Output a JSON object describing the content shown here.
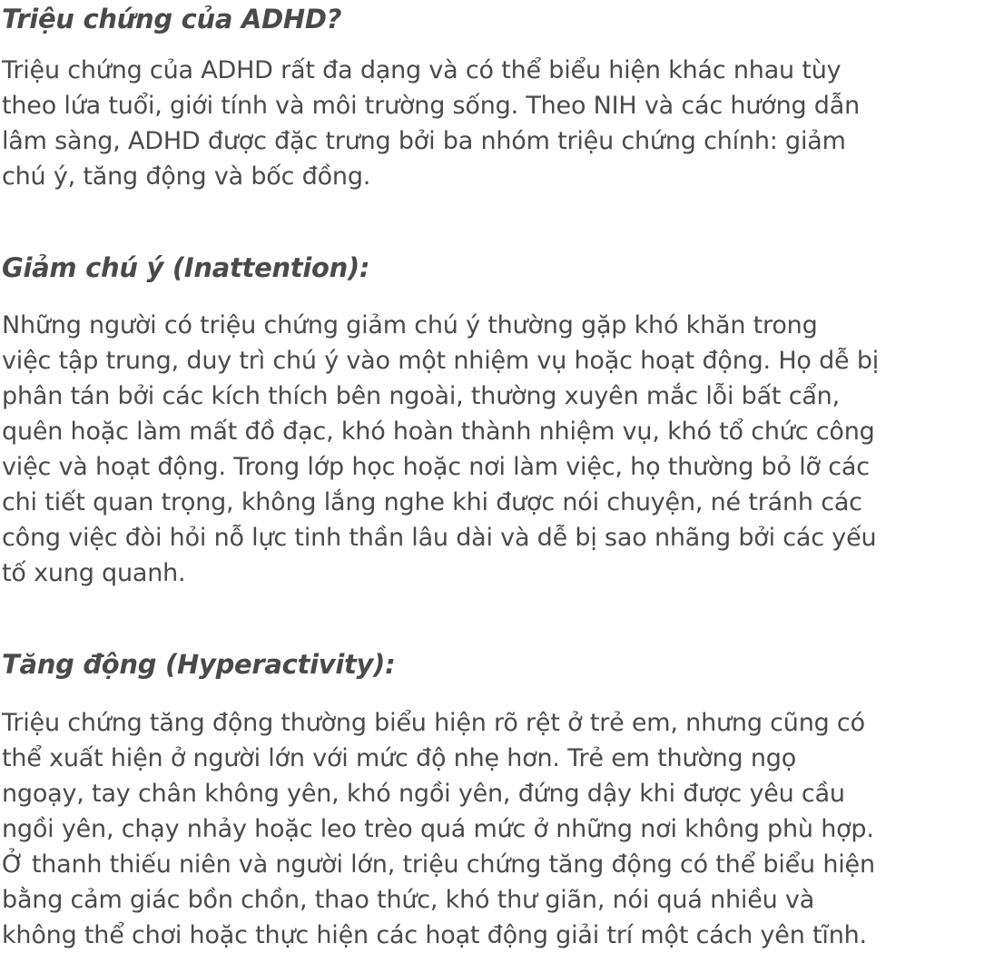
{
  "sections": [
    {
      "heading": "Triệu chứng của ADHD?",
      "lines": [
        "Triệu chứng của ADHD rất đa dạng và có thể biểu hiện khác nhau tùy",
        "theo lứa tuổi, giới tính và môi trường sống. Theo NIH và các hướng dẫn",
        "lâm sàng, ADHD được đặc trưng bởi ba nhóm triệu chứng chính: giảm",
        "chú ý, tăng động và bốc đồng."
      ]
    },
    {
      "heading": "Giảm chú ý (Inattention):",
      "lines": [
        "Những người có triệu chứng giảm chú ý thường gặp khó khăn trong",
        "việc tập trung, duy trì chú ý vào một nhiệm vụ hoặc hoạt động. Họ dễ bị",
        "phân tán bởi các kích thích bên ngoài, thường xuyên mắc lỗi bất cẩn,",
        "quên hoặc làm mất đồ đạc, khó hoàn thành nhiệm vụ, khó tổ chức công",
        "việc và hoạt động. Trong lớp học hoặc nơi làm việc, họ thường bỏ lỡ các",
        "chi tiết quan trọng, không lắng nghe khi được nói chuyện, né tránh các",
        "công việc đòi hỏi nỗ lực tinh thần lâu dài và dễ bị sao nhãng bởi các yếu",
        "tố xung quanh."
      ]
    },
    {
      "heading": "Tăng động (Hyperactivity):",
      "lines": [
        "Triệu chứng tăng động thường biểu hiện rõ rệt ở trẻ em, nhưng cũng có",
        "thể xuất hiện ở người lớn với mức độ nhẹ hơn. Trẻ em thường ngọ",
        "ngoạy, tay chân không yên, khó ngồi yên, đứng dậy khi được yêu cầu",
        "ngồi yên, chạy nhảy hoặc leo trèo quá mức ở những nơi không phù hợp.",
        "Ở thanh thiếu niên và người lớn, triệu chứng tăng động có thể biểu hiện",
        "bằng cảm giác bồn chồn, thao thức, khó thư giãn, nói quá nhiều và",
        "không thể chơi hoặc thực hiện các hoạt động giải trí một cách yên tĩnh."
      ]
    }
  ]
}
